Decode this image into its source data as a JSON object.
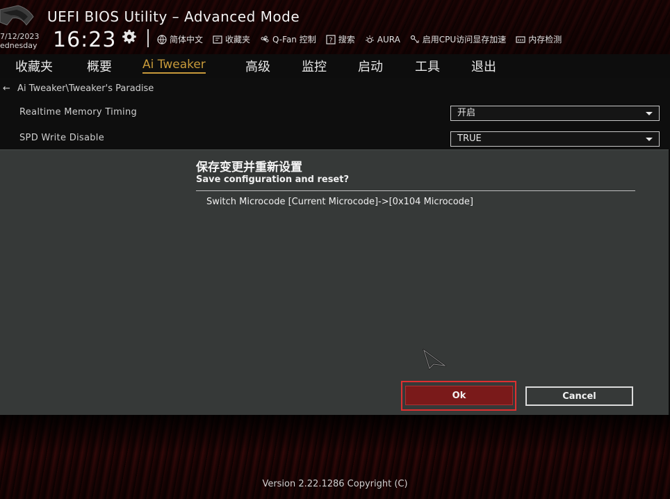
{
  "header": {
    "title": "UEFI BIOS Utility – Advanced Mode",
    "date": "7/12/2023",
    "weekday": "ednesday",
    "time": "16:23",
    "toolbar": [
      {
        "icon": "globe-icon",
        "label": "简体中文"
      },
      {
        "icon": "bookmark-icon",
        "label": "收藏夹"
      },
      {
        "icon": "fan-icon",
        "label": "Q-Fan 控制"
      },
      {
        "icon": "help-icon",
        "label": "搜索"
      },
      {
        "icon": "aura-icon",
        "label": "AURA"
      },
      {
        "icon": "memory-icon",
        "label": "启用CPU访问显存加速"
      },
      {
        "icon": "ram-icon",
        "label": "内存检测"
      }
    ]
  },
  "menu": {
    "items": [
      "收藏夹",
      "概要",
      "Ai Tweaker",
      "高级",
      "监控",
      "启动",
      "工具",
      "退出"
    ],
    "active": "Ai Tweaker"
  },
  "content": {
    "breadcrumb": "Ai Tweaker\\Tweaker's Paradise",
    "back_glyph": "←",
    "rows": [
      {
        "label": "Realtime Memory Timing",
        "value": "开启"
      },
      {
        "label": "SPD Write Disable",
        "value": "TRUE"
      }
    ]
  },
  "dialog": {
    "title_cn": "保存变更并重新设置",
    "title_en": "Save configuration and reset?",
    "message": "Switch Microcode [Current Microcode]->[0x104 Microcode]",
    "ok_label": "Ok",
    "cancel_label": "Cancel"
  },
  "footer": {
    "version": "Version 2.22.1286 Copyright (C)"
  },
  "colors": {
    "accent_active_menu": "#c89a3a",
    "ok_button": "#7a1a1a",
    "highlight_frame": "#e03030",
    "dialog_bg": "#363938"
  }
}
